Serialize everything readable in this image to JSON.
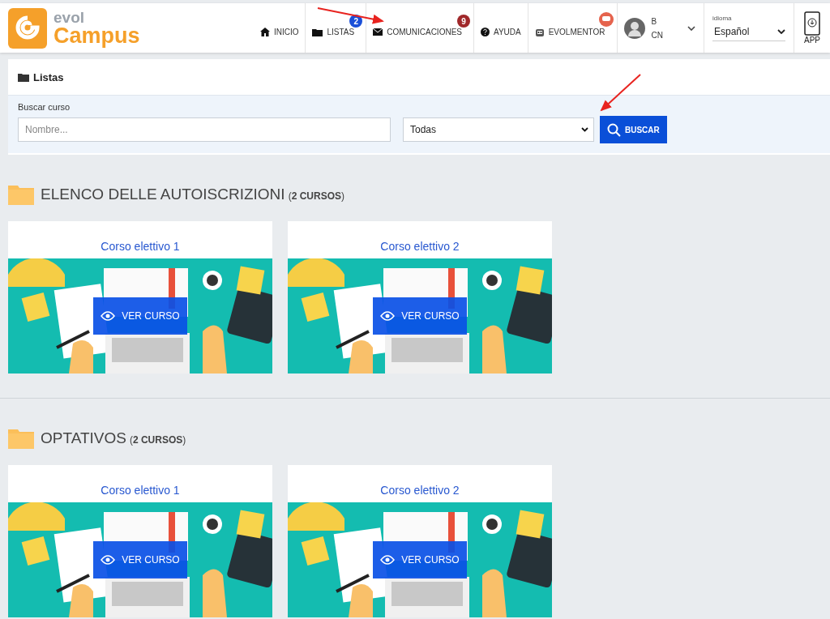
{
  "header": {
    "logo": {
      "line1": "evol",
      "line2": "Campus"
    },
    "nav": [
      {
        "kind": "home",
        "label": "INICIO"
      },
      {
        "kind": "folder",
        "label": "LISTAS",
        "badge": "2",
        "color": "#1a4fd8"
      },
      {
        "kind": "mail",
        "label": "COMUNICACIONES",
        "badge": "9",
        "color": "#a0282a"
      },
      {
        "kind": "help",
        "label": "AYUDA"
      },
      {
        "kind": "mentor",
        "label": "EVOLMENTOR",
        "chat_badge": true
      }
    ],
    "user": {
      "line1": "B",
      "line2": "CN"
    },
    "language": {
      "label": "idioma",
      "value": "Español"
    },
    "app": {
      "label": "APP"
    }
  },
  "panel": {
    "title": "Listas",
    "search_label": "Buscar curso",
    "placeholder": "Nombre...",
    "filter": "Todas",
    "button": "BUSCAR"
  },
  "sections": [
    {
      "title": "ELENCO DELLE AUTOISCRIZIONI",
      "count": "(**2 CURSOS**)",
      "courses": [
        {
          "title": "Corso elettivo 1",
          "action": "VER CURSO"
        },
        {
          "title": "Corso elettivo 2",
          "action": "VER CURSO"
        }
      ]
    },
    {
      "title": "OPTATIVOS",
      "count": "(**2 CURSOS**)",
      "courses": [
        {
          "title": "Corso elettivo 1",
          "action": "VER CURSO"
        },
        {
          "title": "Corso elettivo 2",
          "action": "VER CURSO"
        }
      ]
    }
  ]
}
